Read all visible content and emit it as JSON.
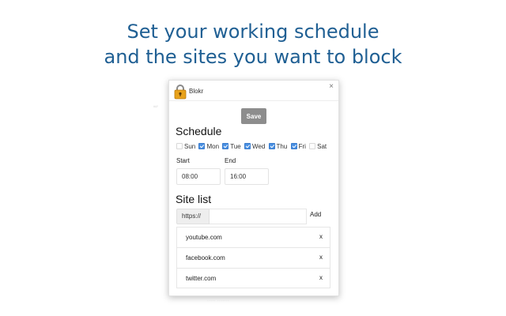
{
  "headline": {
    "line1": "Set your working schedule",
    "line2": "and the sites you want to block"
  },
  "colors": {
    "headline": "#1f5f93",
    "checkbox_checked": "#4a90e2",
    "save_button": "#8d8d8d"
  },
  "popup": {
    "title": "Blokr",
    "icon": "lock-icon",
    "close_label": "×",
    "save_label": "Save",
    "schedule": {
      "title": "Schedule",
      "days": [
        {
          "label": "Sun",
          "checked": false
        },
        {
          "label": "Mon",
          "checked": true
        },
        {
          "label": "Tue",
          "checked": true
        },
        {
          "label": "Wed",
          "checked": true
        },
        {
          "label": "Thu",
          "checked": true
        },
        {
          "label": "Fri",
          "checked": true
        },
        {
          "label": "Sat",
          "checked": false
        }
      ],
      "start_label": "Start",
      "start_value": "08:00",
      "end_label": "End",
      "end_value": "16:00"
    },
    "site_list": {
      "title": "Site list",
      "prefix": "https://",
      "input_value": "",
      "add_label": "Add",
      "remove_label": "x",
      "sites": [
        "youtube.com",
        "facebook.com",
        "twitter.com"
      ]
    }
  }
}
